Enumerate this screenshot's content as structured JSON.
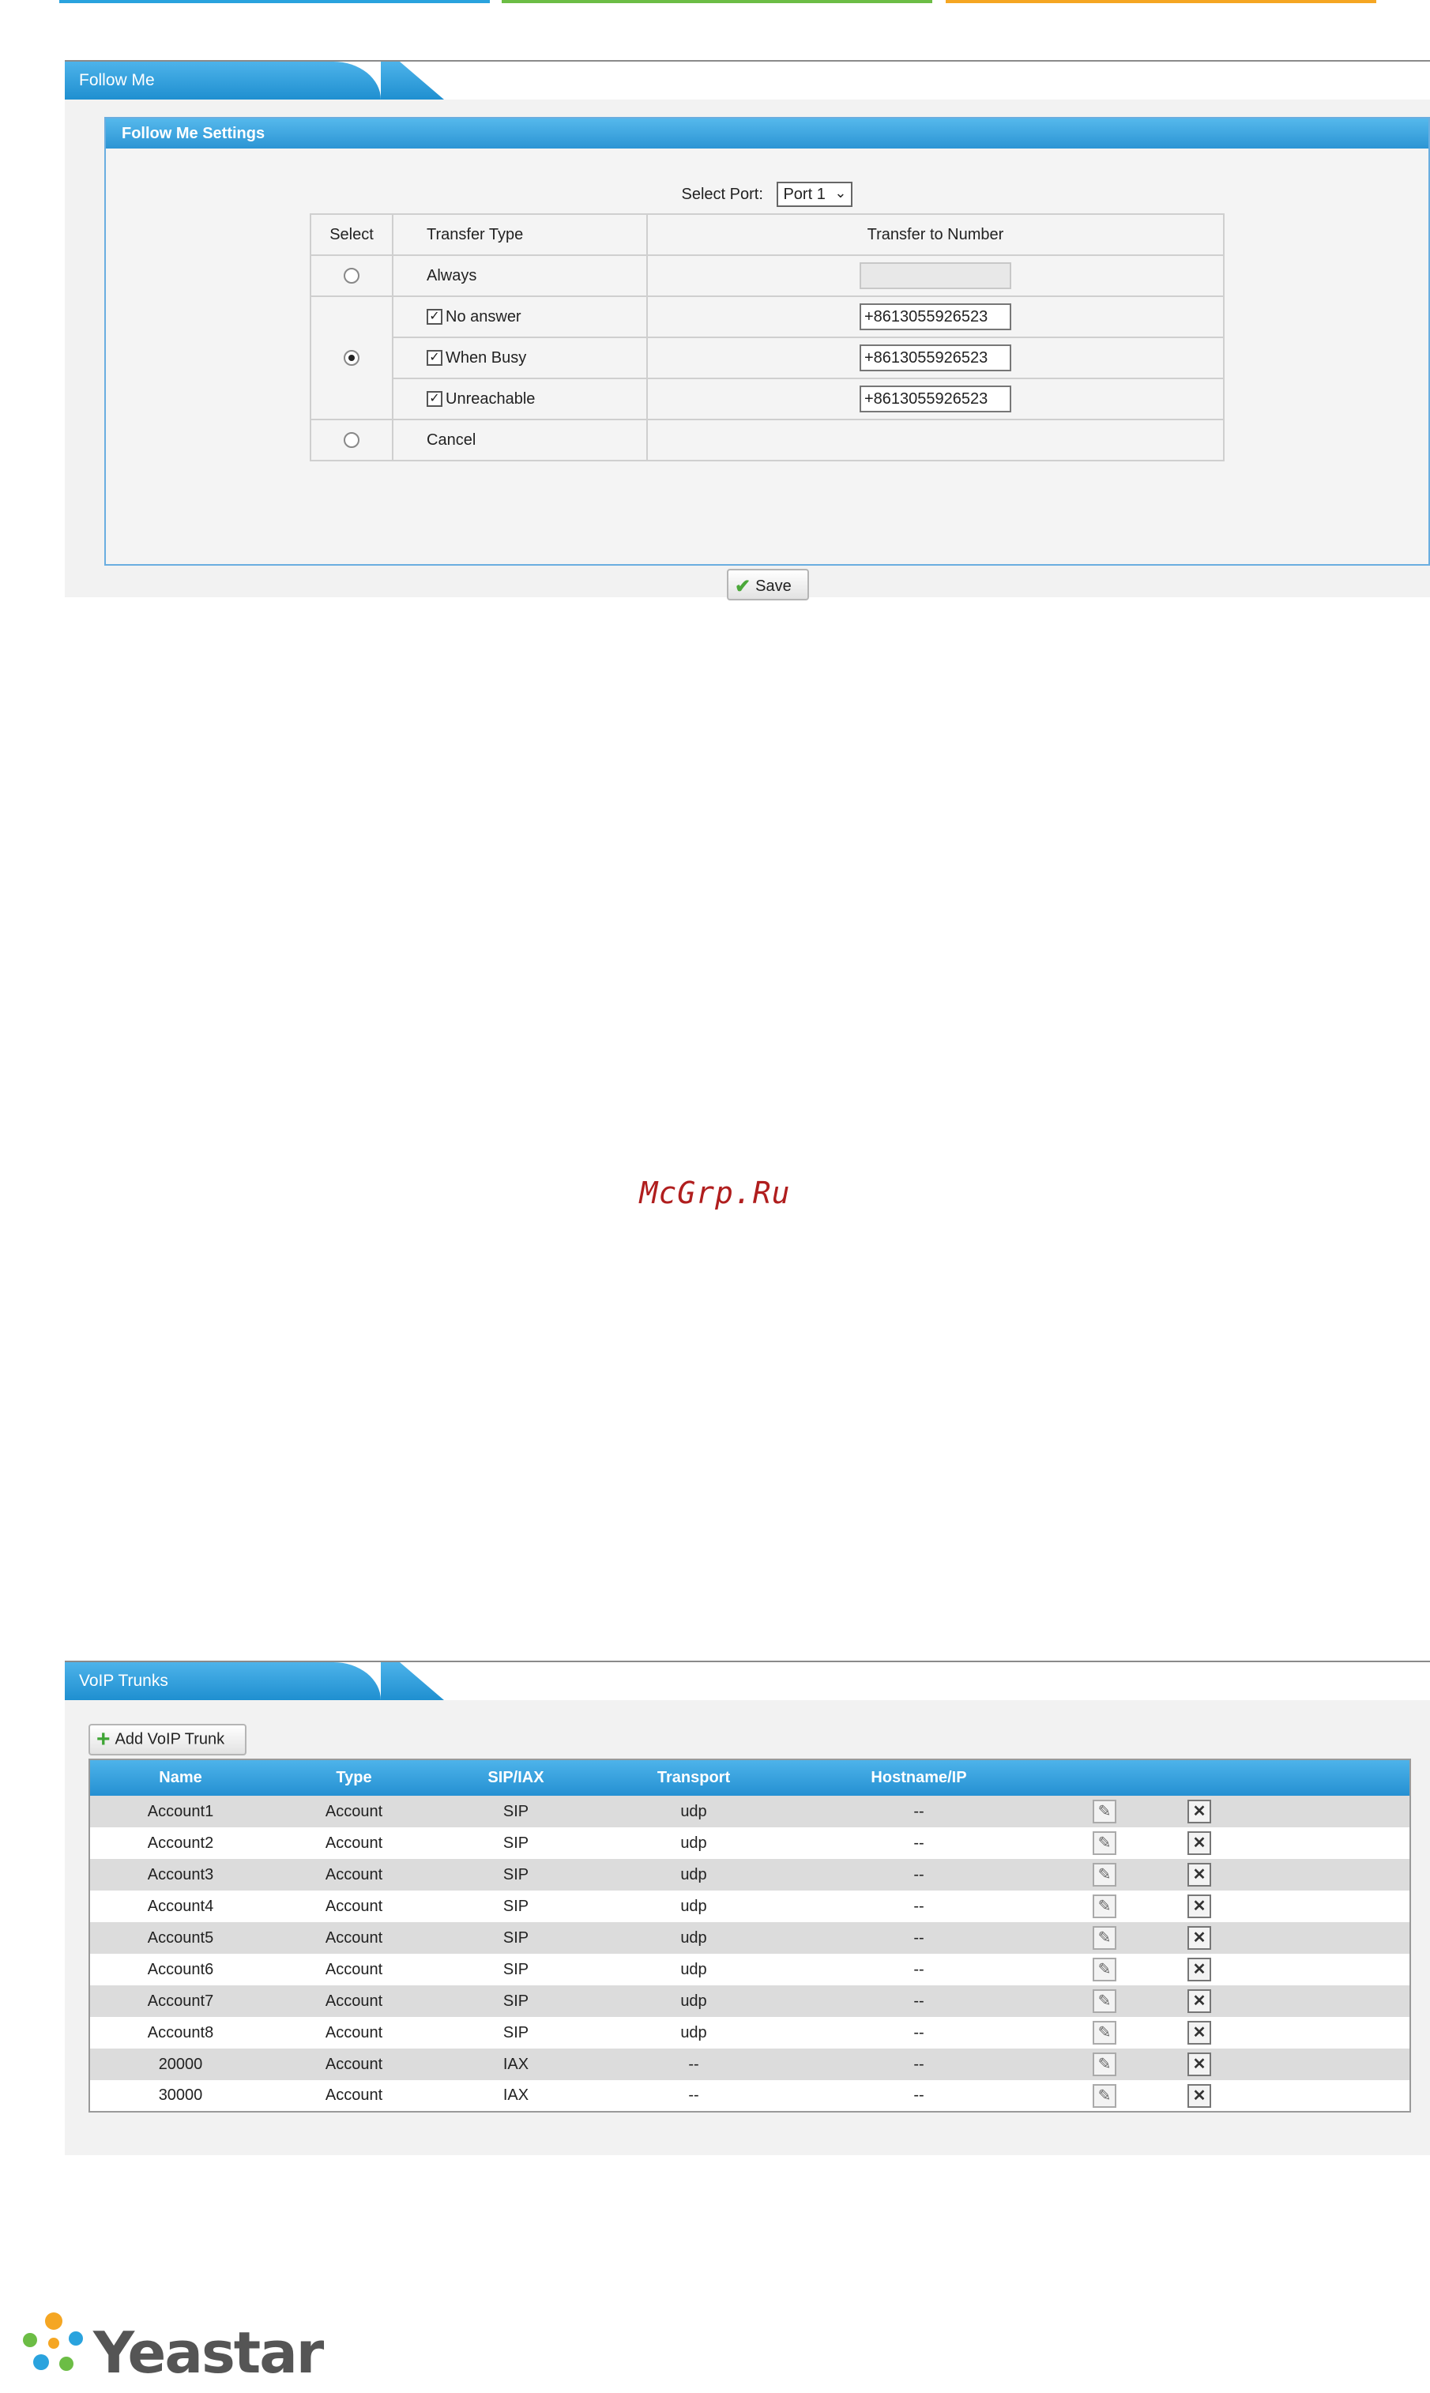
{
  "follow_me": {
    "tab_title": "Follow Me",
    "box_title": "Follow Me Settings",
    "select_port_label": "Select Port:",
    "select_port_value": "Port 1",
    "headers": [
      "Select",
      "Transfer Type",
      "Transfer to Number"
    ],
    "rows": {
      "always": "Always",
      "no_answer": "No answer",
      "when_busy": "When Busy",
      "unreachable": "Unreachable",
      "cancel": "Cancel"
    },
    "numbers": {
      "no_answer": "+8613055926523",
      "when_busy": "+8613055926523",
      "unreachable": "+8613055926523"
    },
    "save_label": "Save"
  },
  "watermark": "McGrp.Ru",
  "voip": {
    "tab_title": "VoIP Trunks",
    "add_label": "Add VoIP Trunk",
    "headers": [
      "Name",
      "Type",
      "SIP/IAX",
      "Transport",
      "Hostname/IP"
    ],
    "rows": [
      [
        "Account1",
        "Account",
        "SIP",
        "udp",
        "--"
      ],
      [
        "Account2",
        "Account",
        "SIP",
        "udp",
        "--"
      ],
      [
        "Account3",
        "Account",
        "SIP",
        "udp",
        "--"
      ],
      [
        "Account4",
        "Account",
        "SIP",
        "udp",
        "--"
      ],
      [
        "Account5",
        "Account",
        "SIP",
        "udp",
        "--"
      ],
      [
        "Account6",
        "Account",
        "SIP",
        "udp",
        "--"
      ],
      [
        "Account7",
        "Account",
        "SIP",
        "udp",
        "--"
      ],
      [
        "Account8",
        "Account",
        "SIP",
        "udp",
        "--"
      ],
      [
        "20000",
        "Account",
        "IAX",
        "--",
        "--"
      ],
      [
        "30000",
        "Account",
        "IAX",
        "--",
        "--"
      ]
    ]
  },
  "logo_text": "Yeastar",
  "colors": {
    "accent_blue": "#2590d2",
    "bar_blue": "#2aa3de",
    "bar_green": "#6cbd45",
    "bar_orange": "#f5a623"
  }
}
